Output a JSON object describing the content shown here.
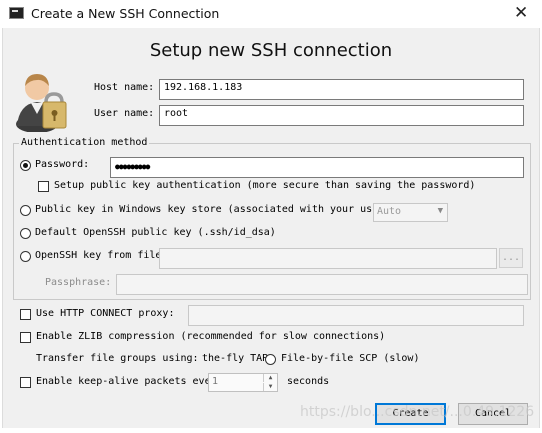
{
  "window": {
    "title": "Create a New SSH Connection",
    "close_glyph": "✕"
  },
  "heading": "Setup new SSH connection",
  "host": {
    "label": "Host name:",
    "value": "192.168.1.183"
  },
  "user": {
    "label": "User name:",
    "value": "root"
  },
  "auth": {
    "legend": "Authentication method",
    "password_label": "Password:",
    "password_value": "●●●●●●●●●",
    "setup_pubkey_label": "Setup public key authentication (more secure than saving the password)",
    "winstore_label": "Public key in Windows key store (associated with your us",
    "winstore_combo": "Auto",
    "default_openssh_label": "Default OpenSSH public key (.ssh/id_dsa)",
    "openssh_file_label": "OpenSSH key from file:",
    "browse_label": "...",
    "passphrase_label": "Passphrase:"
  },
  "proxy": {
    "label": "Use HTTP CONNECT proxy:"
  },
  "zlib": {
    "label": "Enable ZLIB compression (recommended for slow connections)"
  },
  "transfer": {
    "label": "Transfer file groups using:",
    "onthefly_label": "the-fly TAR",
    "filebyfile_label": "File-by-file SCP (slow)"
  },
  "keepalive": {
    "label": "Enable keep-alive packets eve",
    "value": "1",
    "unit": "seconds"
  },
  "buttons": {
    "create": "Create",
    "cancel": "Cancel"
  },
  "watermark": "https://blo...csdn.net/...0.49.1226",
  "colors": {
    "accent": "#0078d7",
    "dialog_bg": "#f0f0f0"
  }
}
